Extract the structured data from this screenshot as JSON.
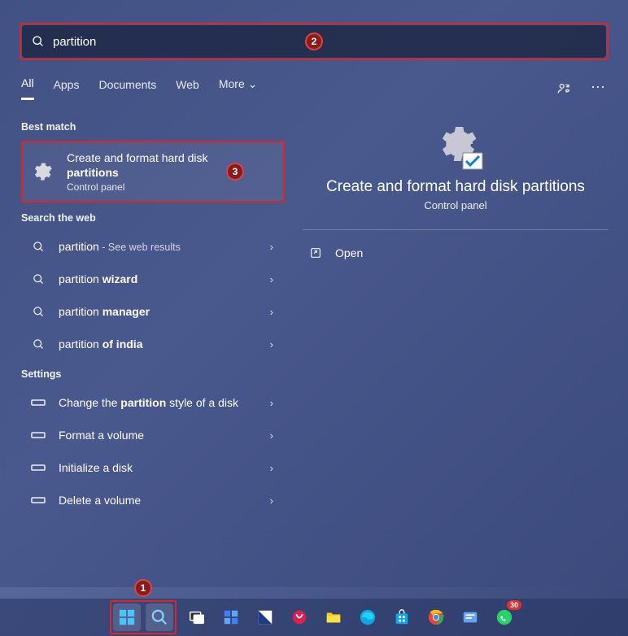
{
  "search": {
    "value": "partition"
  },
  "tabs": [
    "All",
    "Apps",
    "Documents",
    "Web",
    "More"
  ],
  "sections": {
    "best_match_label": "Best match",
    "web_label": "Search the web",
    "settings_label": "Settings"
  },
  "best_match": {
    "line1": "Create and format hard disk",
    "line2": "partitions",
    "sub": "Control panel"
  },
  "web_results": [
    {
      "prefix": "partition",
      "bold": "",
      "suffix": " - See web results"
    },
    {
      "prefix": "partition ",
      "bold": "wizard",
      "suffix": ""
    },
    {
      "prefix": "partition ",
      "bold": "manager",
      "suffix": ""
    },
    {
      "prefix": "partition ",
      "bold": "of india",
      "suffix": ""
    }
  ],
  "settings_results": [
    {
      "pre": "Change the ",
      "bold": "partition",
      "post": " style of a disk"
    },
    {
      "pre": "Format a volume",
      "bold": "",
      "post": ""
    },
    {
      "pre": "Initialize a disk",
      "bold": "",
      "post": ""
    },
    {
      "pre": "Delete a volume",
      "bold": "",
      "post": ""
    }
  ],
  "preview": {
    "title": "Create and format hard disk partitions",
    "sub": "Control panel",
    "open_label": "Open"
  },
  "annotations": {
    "b1": "1",
    "b2": "2",
    "b3": "3"
  },
  "taskbar": {
    "whatsapp_badge": "30"
  }
}
